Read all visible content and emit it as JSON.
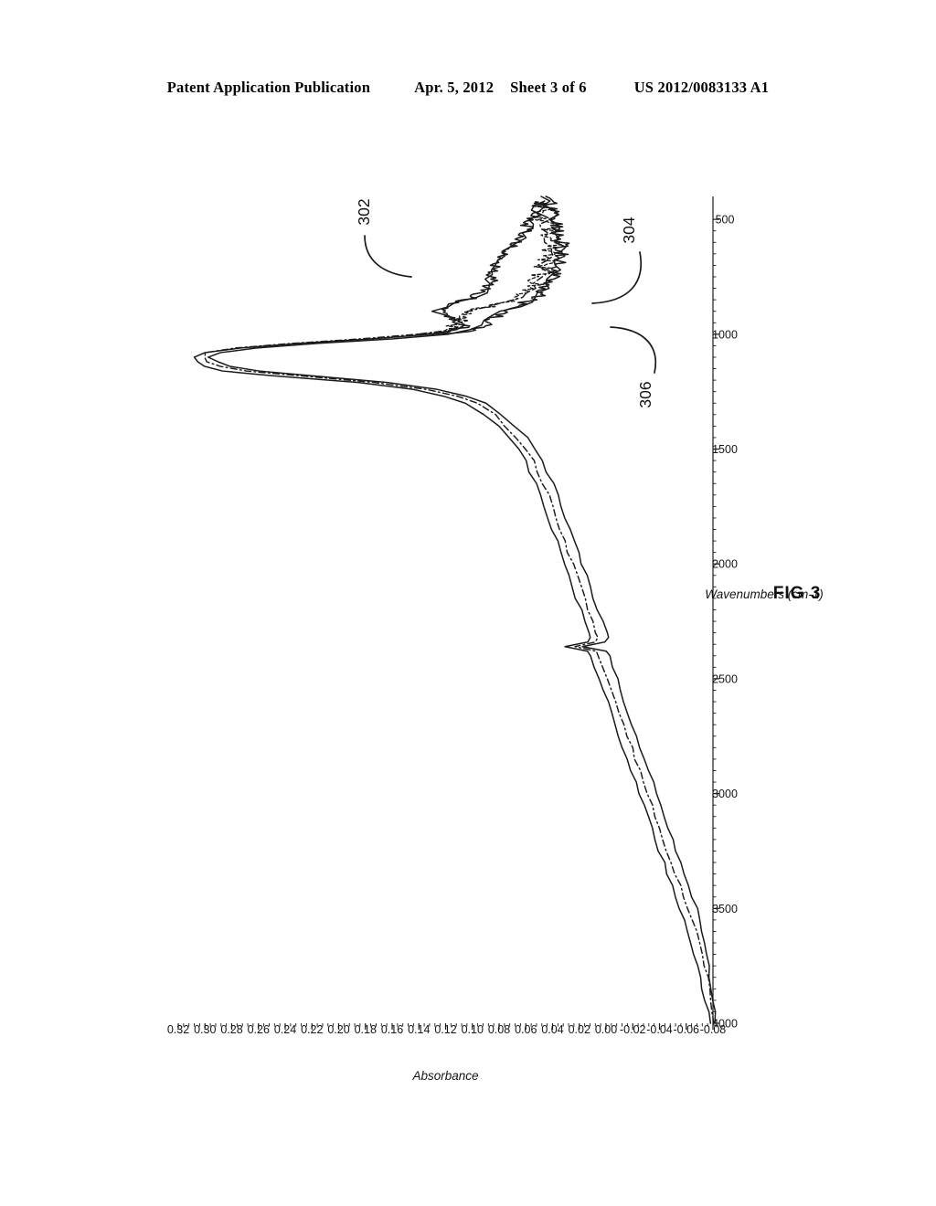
{
  "header": {
    "publication": "Patent Application Publication",
    "date": "Apr. 5, 2012",
    "sheet": "Sheet 3 of 6",
    "docnumber": "US 2012/0083133 A1"
  },
  "figure": {
    "caption": "FIG 3",
    "rotation_degrees": -90,
    "reference_numerals": [
      {
        "id": "302",
        "label": "302"
      },
      {
        "id": "304",
        "label": "304"
      },
      {
        "id": "306",
        "label": "306"
      }
    ]
  },
  "chart_data": {
    "type": "line",
    "title": "FIG 3",
    "xlabel": "Wavenumbers (cm-1)",
    "ylabel": "Absorbance",
    "xlim": [
      4000,
      400
    ],
    "ylim": [
      -0.08,
      0.32
    ],
    "x_reversed": true,
    "grid": false,
    "legend": "none",
    "xticks": [
      4000,
      3500,
      3000,
      2500,
      2000,
      1500,
      1000,
      500
    ],
    "xticklabels": [
      "4000",
      "3500",
      "3000",
      "2500",
      "2000",
      "1500",
      "1000",
      "500"
    ],
    "yticks": [
      0.32,
      0.3,
      0.28,
      0.26,
      0.24,
      0.22,
      0.2,
      0.18,
      0.16,
      0.14,
      0.12,
      0.1,
      0.08,
      0.06,
      0.04,
      0.02,
      0.0,
      -0.02,
      -0.04,
      -0.06,
      -0.08
    ],
    "yticklabels": [
      "0.32",
      "0.30",
      "0.28",
      "0.26",
      "0.24",
      "0.22",
      "0.20",
      "0.18",
      "0.16",
      "0.14",
      "0.12",
      "0.10",
      "0.08",
      "0.06",
      "0.04",
      "0.02",
      "0.00",
      "-0.02",
      "-0.04",
      "-0.06",
      "-0.08"
    ],
    "annotations": [
      {
        "text": "302",
        "points_to_series": "302"
      },
      {
        "text": "304",
        "points_to_series": "304"
      },
      {
        "text": "306",
        "points_to_series": "306"
      }
    ],
    "series": [
      {
        "name": "302",
        "style": "solid",
        "x": [
          4000,
          3950,
          3900,
          3850,
          3800,
          3750,
          3700,
          3650,
          3600,
          3550,
          3500,
          3450,
          3400,
          3350,
          3300,
          3250,
          3200,
          3150,
          3100,
          3050,
          3000,
          2950,
          2900,
          2850,
          2800,
          2750,
          2700,
          2650,
          2600,
          2550,
          2500,
          2450,
          2400,
          2380,
          2360,
          2340,
          2320,
          2300,
          2250,
          2200,
          2150,
          2100,
          2050,
          2000,
          1950,
          1900,
          1850,
          1800,
          1750,
          1700,
          1650,
          1600,
          1550,
          1500,
          1450,
          1400,
          1350,
          1300,
          1270,
          1240,
          1210,
          1180,
          1160,
          1140,
          1120,
          1100,
          1080,
          1060,
          1040,
          1020,
          1000,
          980,
          960,
          940,
          920,
          900,
          880,
          860,
          840,
          820,
          800,
          780,
          760,
          740,
          720,
          700,
          680,
          660,
          640,
          620,
          600,
          580,
          560,
          540,
          520,
          500,
          480,
          460,
          440,
          420,
          400
        ],
        "y": [
          -0.078,
          -0.076,
          -0.074,
          -0.072,
          -0.07,
          -0.068,
          -0.066,
          -0.064,
          -0.061,
          -0.058,
          -0.055,
          -0.052,
          -0.049,
          -0.046,
          -0.043,
          -0.04,
          -0.037,
          -0.034,
          -0.031,
          -0.028,
          -0.025,
          -0.022,
          -0.019,
          -0.016,
          -0.013,
          -0.01,
          -0.007,
          -0.004,
          -0.001,
          0.002,
          0.005,
          0.008,
          0.011,
          0.013,
          0.03,
          0.013,
          0.012,
          0.013,
          0.016,
          0.019,
          0.022,
          0.025,
          0.028,
          0.031,
          0.034,
          0.037,
          0.04,
          0.043,
          0.046,
          0.049,
          0.053,
          0.057,
          0.061,
          0.066,
          0.072,
          0.08,
          0.09,
          0.105,
          0.12,
          0.145,
          0.185,
          0.25,
          0.285,
          0.3,
          0.305,
          0.306,
          0.3,
          0.275,
          0.23,
          0.175,
          0.13,
          0.11,
          0.106,
          0.112,
          0.12,
          0.125,
          0.122,
          0.112,
          0.1,
          0.092,
          0.088,
          0.086,
          0.085,
          0.084,
          0.083,
          0.082,
          0.08,
          0.077,
          0.073,
          0.069,
          0.066,
          0.064,
          0.062,
          0.06,
          0.058,
          0.056,
          0.054,
          0.052,
          0.05,
          0.048
        ]
      },
      {
        "name": "304",
        "style": "dash-dot",
        "x": [
          4000,
          3950,
          3900,
          3850,
          3800,
          3750,
          3700,
          3650,
          3600,
          3550,
          3500,
          3450,
          3400,
          3350,
          3300,
          3250,
          3200,
          3150,
          3100,
          3050,
          3000,
          2950,
          2900,
          2850,
          2800,
          2750,
          2700,
          2650,
          2600,
          2550,
          2500,
          2450,
          2400,
          2380,
          2360,
          2340,
          2320,
          2300,
          2250,
          2200,
          2150,
          2100,
          2050,
          2000,
          1950,
          1900,
          1850,
          1800,
          1750,
          1700,
          1650,
          1600,
          1550,
          1500,
          1450,
          1400,
          1350,
          1300,
          1270,
          1240,
          1210,
          1180,
          1160,
          1140,
          1120,
          1100,
          1080,
          1060,
          1040,
          1020,
          1000,
          980,
          960,
          940,
          920,
          900,
          880,
          860,
          840,
          820,
          800,
          780,
          760,
          740,
          720,
          700,
          680,
          660,
          640,
          620,
          600,
          580,
          560,
          540,
          520,
          500,
          480,
          460,
          440,
          420,
          400
        ],
        "y": [
          -0.08,
          -0.079,
          -0.078,
          -0.077,
          -0.076,
          -0.074,
          -0.072,
          -0.07,
          -0.067,
          -0.064,
          -0.061,
          -0.058,
          -0.055,
          -0.052,
          -0.049,
          -0.046,
          -0.043,
          -0.04,
          -0.037,
          -0.034,
          -0.031,
          -0.028,
          -0.025,
          -0.022,
          -0.019,
          -0.016,
          -0.013,
          -0.01,
          -0.007,
          -0.004,
          -0.001,
          0.002,
          0.005,
          0.007,
          0.024,
          0.007,
          0.006,
          0.007,
          0.01,
          0.013,
          0.016,
          0.019,
          0.022,
          0.025,
          0.028,
          0.031,
          0.034,
          0.037,
          0.04,
          0.043,
          0.047,
          0.051,
          0.055,
          0.06,
          0.066,
          0.074,
          0.084,
          0.098,
          0.112,
          0.135,
          0.172,
          0.232,
          0.268,
          0.288,
          0.298,
          0.302,
          0.298,
          0.276,
          0.235,
          0.182,
          0.14,
          0.118,
          0.112,
          0.11,
          0.108,
          0.1,
          0.088,
          0.076,
          0.066,
          0.06,
          0.056,
          0.054,
          0.052,
          0.05,
          0.048,
          0.046,
          0.044,
          0.042,
          0.041,
          0.04,
          0.04,
          0.041,
          0.042,
          0.043,
          0.044,
          0.045,
          0.046,
          0.047,
          0.048,
          0.049
        ]
      },
      {
        "name": "306",
        "style": "solid",
        "x": [
          4000,
          3950,
          3900,
          3850,
          3800,
          3750,
          3700,
          3650,
          3600,
          3550,
          3500,
          3450,
          3400,
          3350,
          3300,
          3250,
          3200,
          3150,
          3100,
          3050,
          3000,
          2950,
          2900,
          2850,
          2800,
          2750,
          2700,
          2650,
          2600,
          2550,
          2500,
          2450,
          2400,
          2380,
          2360,
          2340,
          2320,
          2300,
          2250,
          2200,
          2150,
          2100,
          2050,
          2000,
          1950,
          1900,
          1850,
          1800,
          1750,
          1700,
          1650,
          1600,
          1550,
          1500,
          1450,
          1400,
          1350,
          1300,
          1270,
          1240,
          1210,
          1180,
          1160,
          1140,
          1120,
          1100,
          1080,
          1060,
          1040,
          1020,
          1000,
          980,
          960,
          940,
          920,
          900,
          880,
          860,
          840,
          820,
          800,
          780,
          760,
          740,
          720,
          700,
          680,
          660,
          640,
          620,
          600,
          580,
          560,
          540,
          520,
          500,
          480,
          460,
          440,
          420,
          400
        ],
        "y": [
          -0.082,
          -0.081,
          -0.08,
          -0.079,
          -0.078,
          -0.077,
          -0.076,
          -0.074,
          -0.072,
          -0.07,
          -0.068,
          -0.065,
          -0.062,
          -0.059,
          -0.056,
          -0.053,
          -0.05,
          -0.047,
          -0.044,
          -0.041,
          -0.038,
          -0.035,
          -0.032,
          -0.029,
          -0.026,
          -0.023,
          -0.02,
          -0.017,
          -0.014,
          -0.011,
          -0.008,
          -0.005,
          -0.002,
          0.0,
          0.018,
          0.0,
          -0.001,
          0.0,
          0.003,
          0.006,
          0.009,
          0.012,
          0.015,
          0.018,
          0.021,
          0.024,
          0.027,
          0.03,
          0.033,
          0.036,
          0.04,
          0.044,
          0.048,
          0.053,
          0.059,
          0.067,
          0.077,
          0.09,
          0.104,
          0.126,
          0.162,
          0.22,
          0.258,
          0.28,
          0.292,
          0.296,
          0.29,
          0.262,
          0.215,
          0.16,
          0.118,
          0.098,
          0.09,
          0.086,
          0.082,
          0.076,
          0.068,
          0.06,
          0.053,
          0.048,
          0.045,
          0.043,
          0.041,
          0.039,
          0.037,
          0.036,
          0.035,
          0.034,
          0.033,
          0.033,
          0.033,
          0.034,
          0.035,
          0.036,
          0.037,
          0.038,
          0.039,
          0.04,
          0.041,
          0.042,
          0.043
        ]
      }
    ]
  }
}
